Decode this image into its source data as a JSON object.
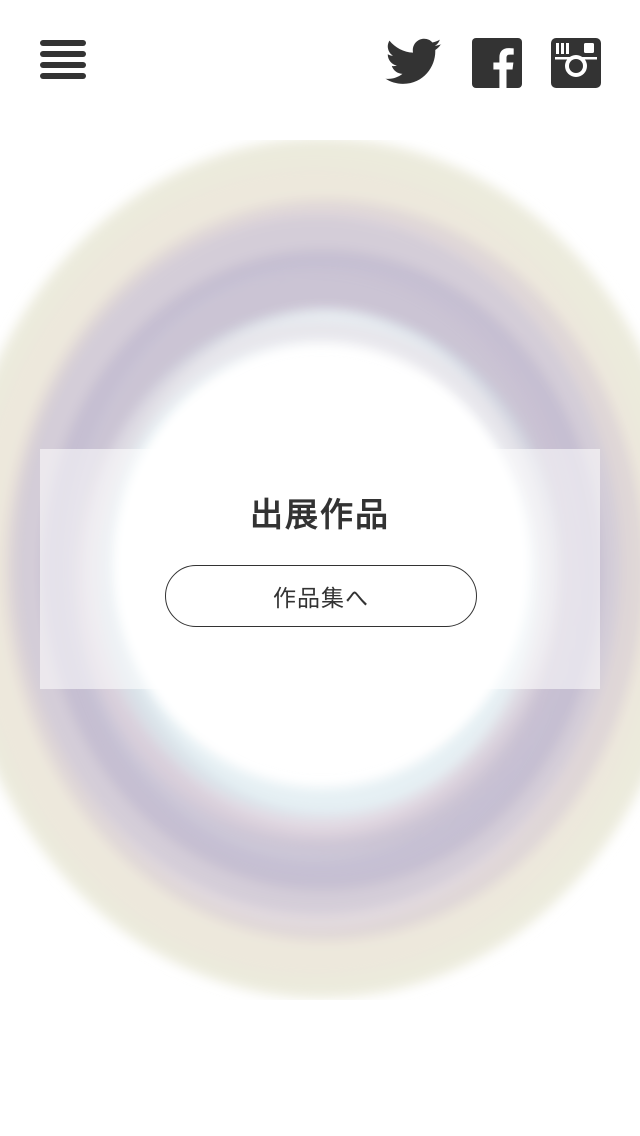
{
  "header": {
    "menu_icon": "hamburger-menu-icon",
    "social": [
      {
        "name": "twitter",
        "icon": "twitter-icon"
      },
      {
        "name": "facebook",
        "icon": "facebook-icon"
      },
      {
        "name": "instagram",
        "icon": "instagram-icon"
      }
    ],
    "icon_color": "#333333"
  },
  "main": {
    "title": "出展作品",
    "button_label": "作品集へ"
  },
  "colors": {
    "text": "#333333",
    "ring_outer": "#e3e2cf",
    "ring_inner": "#b9b5cc",
    "background": "#ffffff"
  }
}
